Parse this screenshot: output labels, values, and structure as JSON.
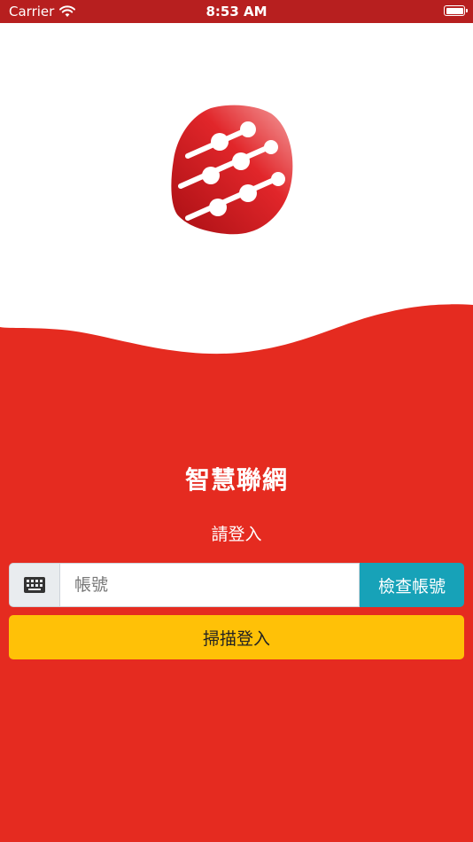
{
  "status_bar": {
    "carrier": "Carrier",
    "time": "8:53 AM",
    "icons": [
      "wifi-icon",
      "battery-icon"
    ]
  },
  "app": {
    "logo_icon": "network-nodes-logo",
    "title": "智慧聯網",
    "subtitle": "請登入"
  },
  "login": {
    "account_placeholder": "帳號",
    "account_value": "",
    "keyboard_icon": "keyboard-icon",
    "check_button_label": "檢查帳號",
    "scan_button_label": "掃描登入"
  },
  "colors": {
    "primary_red": "#e52b20",
    "status_bar": "#b71f1f",
    "check_button": "#17a2b8",
    "scan_button": "#ffc107",
    "hero_background": "#ffffff"
  }
}
